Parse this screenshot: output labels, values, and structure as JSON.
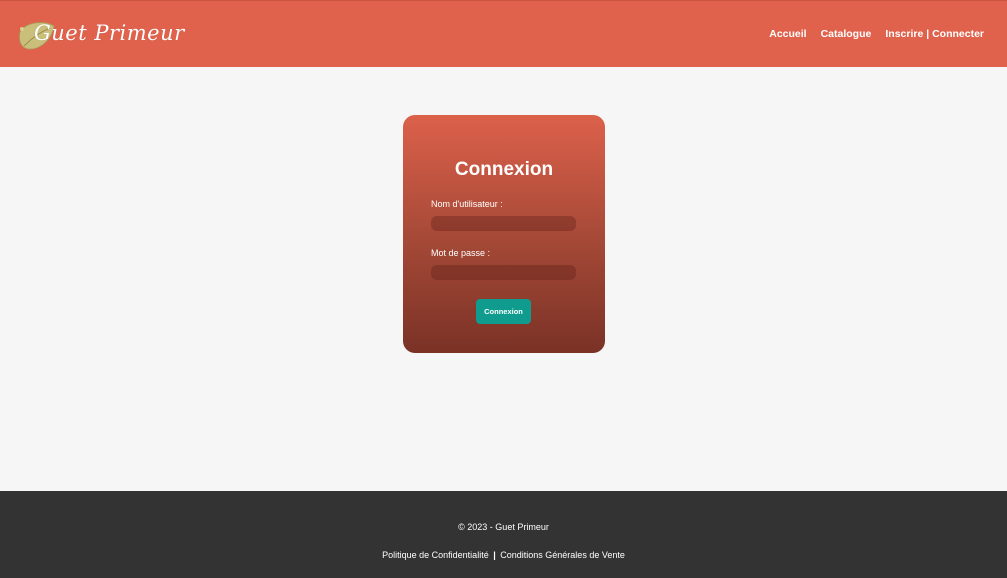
{
  "header": {
    "logo_text": "Guet Primeur",
    "nav": [
      {
        "label": "Accueil"
      },
      {
        "label": "Catalogue"
      },
      {
        "label": "Inscrire | Connecter"
      }
    ]
  },
  "login": {
    "title": "Connexion",
    "username_label": "Nom d'utilisateur :",
    "username_value": "",
    "password_label": "Mot de passe :",
    "password_value": "",
    "submit_label": "Connexion"
  },
  "footer": {
    "copyright": "© 2023 - Guet Primeur",
    "privacy_link": "Politique de Confidentialité",
    "separator": "|",
    "terms_link": "Conditions Générales de Vente"
  },
  "colors": {
    "header_bg": "#e0624c",
    "card_top": "#dc614b",
    "card_bottom": "#7a3226",
    "button_bg": "#0f9b8e",
    "footer_bg": "#333333",
    "page_bg": "#f6f6f6"
  },
  "icons": {
    "logo": "leaf-icon"
  }
}
